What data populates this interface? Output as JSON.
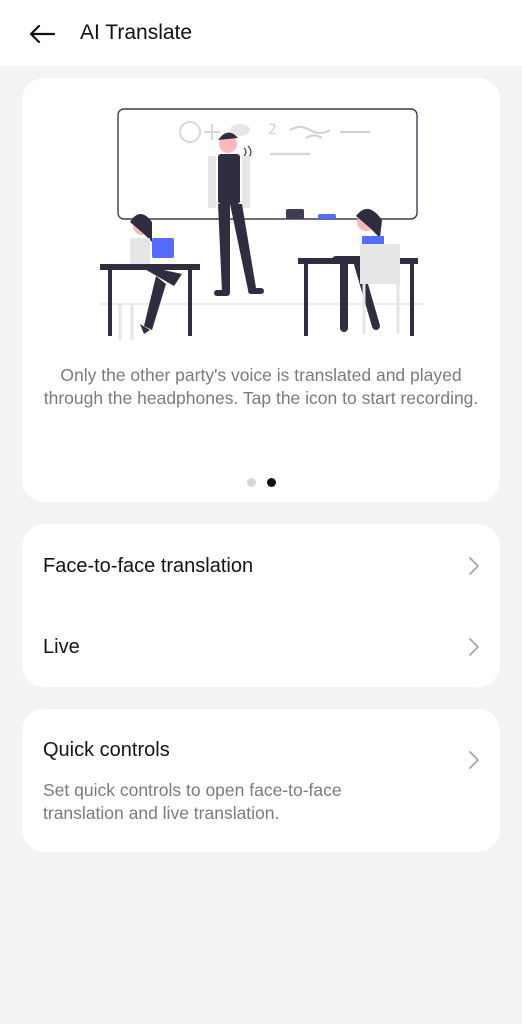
{
  "header": {
    "title": "AI Translate",
    "back_icon": "arrow-left-icon"
  },
  "intro": {
    "caption": "Only the other party's voice is translated and played through the headphones. Tap the icon to start recording.",
    "pager": {
      "total": 2,
      "active": 2
    },
    "accent_color": "#536dfe"
  },
  "menu": {
    "items": [
      {
        "label": "Face-to-face translation",
        "icon": "chevron-right-icon"
      },
      {
        "label": "Live",
        "icon": "chevron-right-icon"
      }
    ]
  },
  "quick_controls": {
    "title": "Quick controls",
    "description": "Set quick controls to open face-to-face translation and live translation.",
    "icon": "chevron-right-icon"
  }
}
